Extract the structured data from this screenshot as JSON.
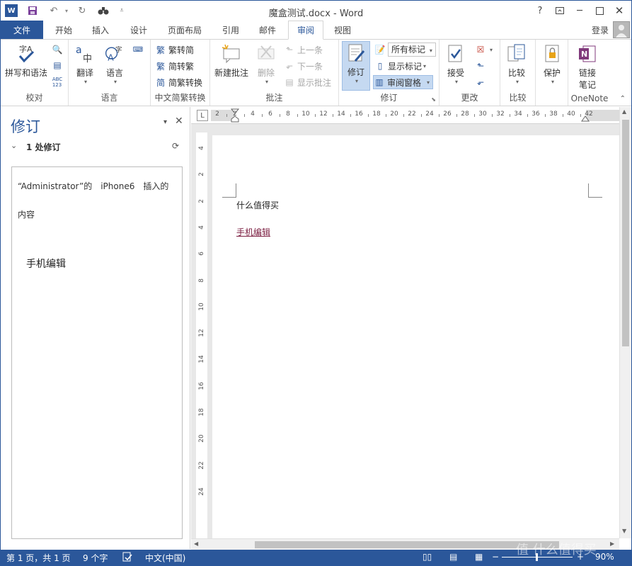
{
  "window": {
    "title": "魔盒测试.docx - Word",
    "login_label": "登录"
  },
  "quick_access": {
    "icons": [
      "word-app-icon",
      "save-icon",
      "undo-icon",
      "redo-icon",
      "binoculars-icon",
      "customize-qat-icon"
    ]
  },
  "tabs": {
    "file": "文件",
    "items": [
      "开始",
      "插入",
      "设计",
      "页面布局",
      "引用",
      "邮件",
      "审阅",
      "视图"
    ],
    "active": "审阅"
  },
  "ribbon": {
    "proofing": {
      "group": "校对",
      "spelling": "拼写和语法"
    },
    "language": {
      "group": "语言",
      "translate": "翻译",
      "language": "语言"
    },
    "chinese": {
      "group": "中文简繁转换",
      "t2s": "繁转简",
      "s2t": "简转繁",
      "convert": "简繁转换"
    },
    "comments": {
      "group": "批注",
      "new": "新建批注",
      "delete": "删除",
      "prev": "上一条",
      "next": "下一条",
      "show": "显示批注"
    },
    "tracking": {
      "group": "修订",
      "track": "修订",
      "markup": "所有标记",
      "show_markup": "显示标记",
      "pane": "审阅窗格"
    },
    "changes": {
      "group": "更改",
      "accept": "接受"
    },
    "compare": {
      "group": "比较",
      "compare": "比较"
    },
    "protect": {
      "group": "",
      "protect": "保护"
    },
    "onenote": {
      "group": "OneNote",
      "link_line1": "链接",
      "link_line2": "笔记"
    }
  },
  "revision_pane": {
    "title": "修订",
    "count": "1 处修订",
    "author_line": "“Administrator”的　iPhone6　插入的",
    "content_label": "内容",
    "inserted_text": "手机编辑"
  },
  "ruler": {
    "h_ticks": [
      "2",
      "2",
      "4",
      "6",
      "8",
      "10",
      "12",
      "14",
      "16",
      "18",
      "20",
      "22",
      "24",
      "26",
      "28",
      "30",
      "32",
      "34",
      "36",
      "38",
      "40",
      "42"
    ],
    "v_ticks": [
      "4",
      "2",
      "2",
      "4",
      "6",
      "8",
      "10",
      "12",
      "14",
      "16",
      "18",
      "20",
      "22",
      "24"
    ]
  },
  "document": {
    "paragraph1": "什么值得买",
    "paragraph2": "手机编辑",
    "insert_color": "#7a1b3f"
  },
  "status": {
    "page": "第 1 页，共 1 页",
    "words": "9 个字",
    "language": "中文(中国)",
    "zoom": "90%",
    "watermark": "值 什么值得买"
  },
  "colors": {
    "accent": "#2b579a"
  }
}
